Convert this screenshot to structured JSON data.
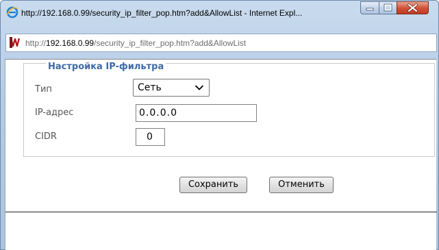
{
  "window": {
    "title": "http://192.168.0.99/security_ip_filter_pop.htm?add&AllowList - Internet Expl..."
  },
  "address_bar": {
    "url_prefix": "http://",
    "url_host": "192.168.0.99",
    "url_path": "/security_ip_filter_pop.htm?add&AllowList"
  },
  "form": {
    "legend": "Настройка IP-фильтра",
    "type_label": "Тип",
    "type_value": "Сеть",
    "ip_label": "IP-адрес",
    "ip_value": "0.0.0.0",
    "cidr_label": "CIDR",
    "cidr_value": "0"
  },
  "buttons": {
    "save": "Сохранить",
    "cancel": "Отменить"
  },
  "icons": {
    "browser": "internet-explorer-icon",
    "site": "favicon-icon",
    "minimize": "minimize-icon",
    "maximize": "maximize-icon",
    "close": "close-icon",
    "dropdown": "chevron-down-icon"
  },
  "colors": {
    "legend": "#3f6aa5",
    "close_button": "#c23a22"
  }
}
